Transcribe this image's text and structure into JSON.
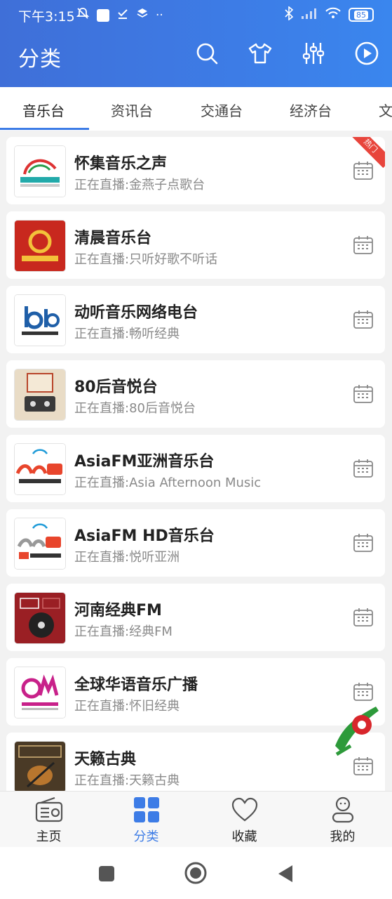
{
  "status_bar": {
    "time": "下午3:15",
    "battery": "85"
  },
  "header": {
    "title": "分类"
  },
  "tabs": [
    {
      "label": "音乐台",
      "active": true
    },
    {
      "label": "资讯台"
    },
    {
      "label": "交通台"
    },
    {
      "label": "经济台"
    },
    {
      "label": "文"
    }
  ],
  "stations": [
    {
      "name": "怀集音乐之声",
      "now_playing": "正在直播:金燕子点歌台",
      "badge": "热门"
    },
    {
      "name": "清晨音乐台",
      "now_playing": "正在直播:只听好歌不听话"
    },
    {
      "name": "动听音乐网络电台",
      "now_playing": "正在直播:畅听经典"
    },
    {
      "name": "80后音悦台",
      "now_playing": "正在直播:80后音悦台"
    },
    {
      "name": "AsiaFM亚洲音乐台",
      "now_playing": "正在直播:Asia Afternoon Music"
    },
    {
      "name": "AsiaFM HD音乐台",
      "now_playing": "正在直播:悦听亚洲"
    },
    {
      "name": "河南经典FM",
      "now_playing": "正在直播:经典FM"
    },
    {
      "name": "全球华语音乐广播",
      "now_playing": "正在直播:怀旧经典"
    },
    {
      "name": "天籁古典",
      "now_playing": "正在直播:天籁古典"
    }
  ],
  "bottom_nav": [
    {
      "label": "主页",
      "icon": "radio-icon"
    },
    {
      "label": "分类",
      "icon": "grid-icon",
      "active": true
    },
    {
      "label": "收藏",
      "icon": "heart-icon"
    },
    {
      "label": "我的",
      "icon": "user-icon"
    }
  ],
  "colors": {
    "accent": "#3d7ce6",
    "hot": "#e8453c"
  }
}
